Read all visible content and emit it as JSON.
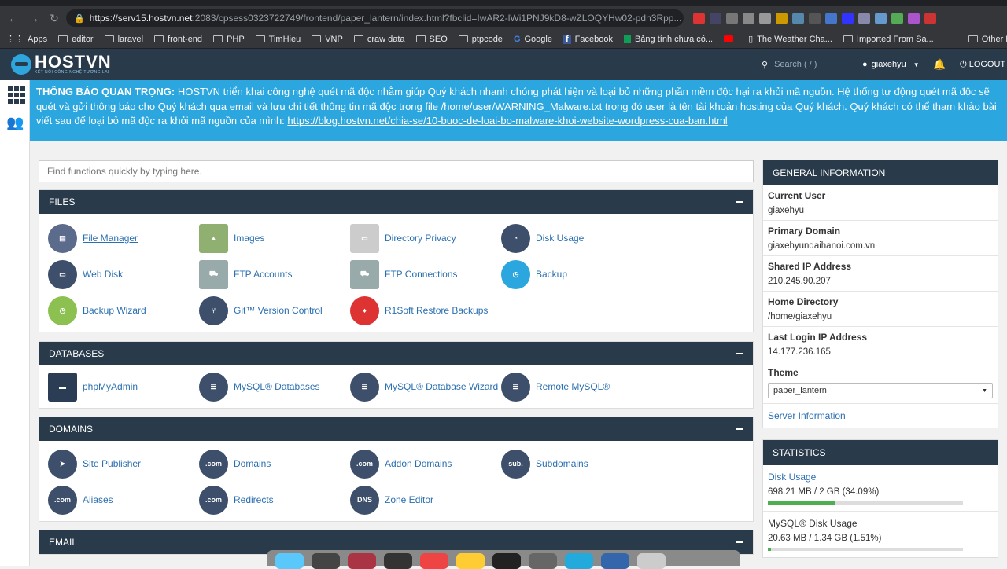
{
  "browser": {
    "url_host": "https://serv15.hostvn.net",
    "url_rest": ":2083/cpsess0323722749/frontend/paper_lantern/index.html?fbclid=IwAR2-lWi1PNJ9kD8-wZLOQYHw02-pdh3Rpp...",
    "bookmarks": [
      "Apps",
      "editor",
      "laravel",
      "front-end",
      "PHP",
      "TimHieu",
      "VNP",
      "craw data",
      "SEO",
      "ptpcode",
      "Google",
      "Facebook",
      "Bảng tính chưa có...",
      "",
      "The Weather Cha...",
      "Imported From Sa...",
      "Other Bookmarks"
    ]
  },
  "header": {
    "logo": "HOSTVN",
    "logo_sub": "KẾT NỐI CÔNG NGHỆ TƯƠNG LAI",
    "search_placeholder": "Search ( / )",
    "user": "giaxehyu",
    "logout": "LOGOUT"
  },
  "notice": {
    "title": "THÔNG BÁO QUAN TRỌNG:",
    "body": " HOSTVN triển khai công nghệ quét mã độc nhằm giúp Quý khách nhanh chóng phát hiện và loại bỏ những phần mềm độc hại ra khỏi mã nguồn. Hệ thống tự động quét mã độc sẽ quét và gửi thông báo cho Quý khách qua email và lưu chi tiết thông tin mã độc trong file /home/user/WARNING_Malware.txt trong đó user là tên tài khoản hosting của Quý khách. Quý khách có thể tham khảo bài viết sau để loại bỏ mã độc ra khỏi mã nguồn của mình: ",
    "link": "https://blog.hostvn.net/chia-se/10-buoc-de-loai-bo-malware-khoi-website-wordpress-cua-ban.html"
  },
  "find_placeholder": "Find functions quickly by typing here.",
  "sections": {
    "files": {
      "title": "FILES",
      "items": [
        "File Manager",
        "Images",
        "Directory Privacy",
        "Disk Usage",
        "Web Disk",
        "FTP Accounts",
        "FTP Connections",
        "Backup",
        "Backup Wizard",
        "Git™ Version Control",
        "R1Soft Restore Backups"
      ]
    },
    "databases": {
      "title": "DATABASES",
      "items": [
        "phpMyAdmin",
        "MySQL® Databases",
        "MySQL® Database Wizard",
        "Remote MySQL®"
      ]
    },
    "domains": {
      "title": "DOMAINS",
      "items": [
        "Site Publisher",
        "Domains",
        "Addon Domains",
        "Subdomains",
        "Aliases",
        "Redirects",
        "Zone Editor"
      ]
    },
    "email": {
      "title": "EMAIL"
    }
  },
  "general": {
    "title": "GENERAL INFORMATION",
    "current_user_label": "Current User",
    "current_user": "giaxehyu",
    "primary_domain_label": "Primary Domain",
    "primary_domain": "giaxehyundaihanoi.com.vn",
    "shared_ip_label": "Shared IP Address",
    "shared_ip": "210.245.90.207",
    "home_dir_label": "Home Directory",
    "home_dir": "/home/giaxehyu",
    "last_login_label": "Last Login IP Address",
    "last_login": "14.177.236.165",
    "theme_label": "Theme",
    "theme": "paper_lantern",
    "server_info": "Server Information"
  },
  "statistics": {
    "title": "STATISTICS",
    "disk_label": "Disk Usage",
    "disk_value": "698.21 MB / 2 GB   (34.09%)",
    "disk_fraction": 0.3409,
    "mysql_label": "MySQL® Disk Usage",
    "mysql_value": "20.63 MB / 1.34 GB   (1.51%)",
    "mysql_fraction": 0.0151
  },
  "colors": {
    "header": "#293a4a",
    "notice": "#2ba6de",
    "link": "#2a6fb1"
  }
}
